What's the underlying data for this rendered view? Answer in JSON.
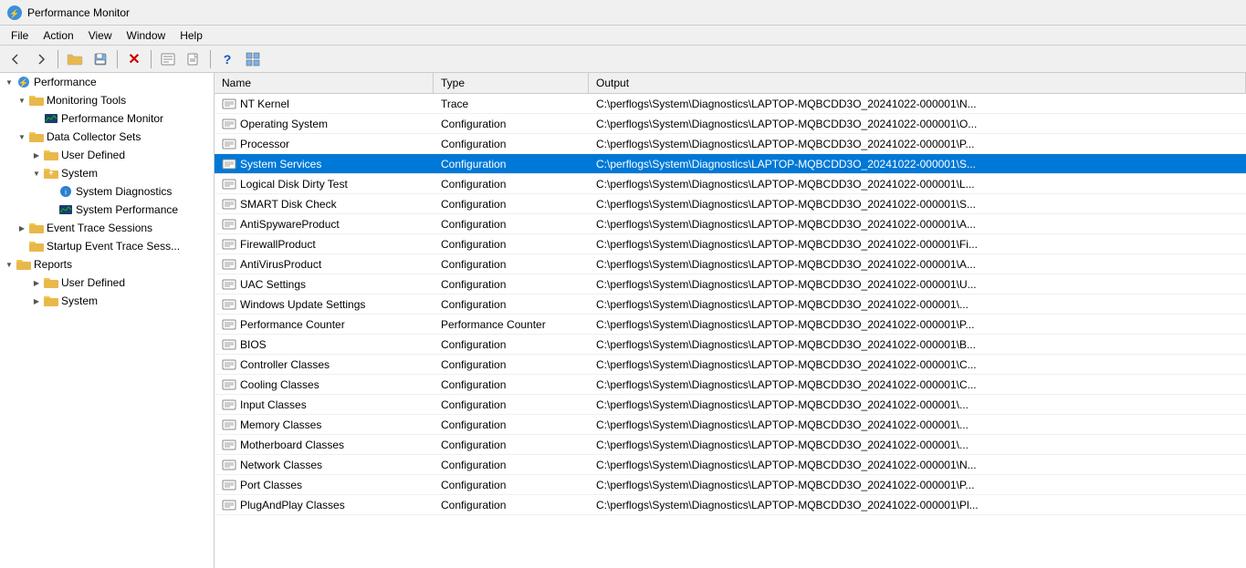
{
  "titleBar": {
    "icon": "●",
    "title": "Performance Monitor"
  },
  "menuBar": {
    "items": [
      "File",
      "Action",
      "View",
      "Window",
      "Help"
    ]
  },
  "toolbar": {
    "buttons": [
      {
        "name": "back",
        "icon": "◄",
        "label": "Back"
      },
      {
        "name": "forward",
        "icon": "►",
        "label": "Forward"
      },
      {
        "name": "separator1",
        "type": "separator"
      },
      {
        "name": "open",
        "icon": "📂",
        "label": "Open"
      },
      {
        "name": "save",
        "icon": "💾",
        "label": "Save"
      },
      {
        "name": "separator2",
        "type": "separator"
      },
      {
        "name": "delete",
        "icon": "✕",
        "label": "Delete"
      },
      {
        "name": "separator3",
        "type": "separator"
      },
      {
        "name": "properties",
        "icon": "≡",
        "label": "Properties"
      },
      {
        "name": "new",
        "icon": "📄",
        "label": "New"
      },
      {
        "name": "separator4",
        "type": "separator"
      },
      {
        "name": "help",
        "icon": "?",
        "label": "Help"
      },
      {
        "name": "view",
        "icon": "⊞",
        "label": "View"
      }
    ]
  },
  "sidebar": {
    "items": [
      {
        "id": "performance",
        "label": "Performance",
        "level": 0,
        "expanded": true,
        "icon": "perf",
        "type": "root"
      },
      {
        "id": "monitoring-tools",
        "label": "Monitoring Tools",
        "level": 1,
        "expanded": true,
        "icon": "folder",
        "type": "folder"
      },
      {
        "id": "performance-monitor",
        "label": "Performance Monitor",
        "level": 2,
        "expanded": false,
        "icon": "monitor",
        "type": "leaf"
      },
      {
        "id": "data-collector-sets",
        "label": "Data Collector Sets",
        "level": 1,
        "expanded": true,
        "icon": "folder",
        "type": "folder"
      },
      {
        "id": "user-defined-1",
        "label": "User Defined",
        "level": 2,
        "expanded": false,
        "icon": "folder",
        "type": "folder"
      },
      {
        "id": "system",
        "label": "System",
        "level": 2,
        "expanded": true,
        "icon": "folder-open",
        "type": "folder"
      },
      {
        "id": "system-diagnostics",
        "label": "System Diagnostics",
        "level": 3,
        "expanded": false,
        "icon": "diag",
        "type": "leaf",
        "selected": false
      },
      {
        "id": "system-performance",
        "label": "System Performance",
        "level": 3,
        "expanded": false,
        "icon": "chart",
        "type": "leaf"
      },
      {
        "id": "event-trace-sessions",
        "label": "Event Trace Sessions",
        "level": 1,
        "expanded": false,
        "icon": "folder",
        "type": "folder"
      },
      {
        "id": "startup-event-trace",
        "label": "Startup Event Trace Sess...",
        "level": 1,
        "expanded": false,
        "icon": "folder",
        "type": "folder"
      },
      {
        "id": "reports",
        "label": "Reports",
        "level": 0,
        "expanded": true,
        "icon": "folder",
        "type": "folder"
      },
      {
        "id": "user-defined-2",
        "label": "User Defined",
        "level": 2,
        "expanded": false,
        "icon": "folder",
        "type": "folder"
      },
      {
        "id": "system-2",
        "label": "System",
        "level": 2,
        "expanded": false,
        "icon": "folder",
        "type": "folder"
      }
    ]
  },
  "listView": {
    "columns": [
      {
        "id": "name",
        "label": "Name"
      },
      {
        "id": "type",
        "label": "Type"
      },
      {
        "id": "output",
        "label": "Output"
      }
    ],
    "rows": [
      {
        "name": "NT Kernel",
        "type": "Trace",
        "output": "C:\\perflogs\\System\\Diagnostics\\LAPTOP-MQBCDD3O_20241022-000001\\N...",
        "selected": false
      },
      {
        "name": "Operating System",
        "type": "Configuration",
        "output": "C:\\perflogs\\System\\Diagnostics\\LAPTOP-MQBCDD3O_20241022-000001\\O...",
        "selected": false
      },
      {
        "name": "Processor",
        "type": "Configuration",
        "output": "C:\\perflogs\\System\\Diagnostics\\LAPTOP-MQBCDD3O_20241022-000001\\P...",
        "selected": false
      },
      {
        "name": "System Services",
        "type": "Configuration",
        "output": "C:\\perflogs\\System\\Diagnostics\\LAPTOP-MQBCDD3O_20241022-000001\\S...",
        "selected": true
      },
      {
        "name": "Logical Disk Dirty Test",
        "type": "Configuration",
        "output": "C:\\perflogs\\System\\Diagnostics\\LAPTOP-MQBCDD3O_20241022-000001\\L...",
        "selected": false
      },
      {
        "name": "SMART Disk Check",
        "type": "Configuration",
        "output": "C:\\perflogs\\System\\Diagnostics\\LAPTOP-MQBCDD3O_20241022-000001\\S...",
        "selected": false
      },
      {
        "name": "AntiSpywareProduct",
        "type": "Configuration",
        "output": "C:\\perflogs\\System\\Diagnostics\\LAPTOP-MQBCDD3O_20241022-000001\\A...",
        "selected": false
      },
      {
        "name": "FirewallProduct",
        "type": "Configuration",
        "output": "C:\\perflogs\\System\\Diagnostics\\LAPTOP-MQBCDD3O_20241022-000001\\Fi...",
        "selected": false
      },
      {
        "name": "AntiVirusProduct",
        "type": "Configuration",
        "output": "C:\\perflogs\\System\\Diagnostics\\LAPTOP-MQBCDD3O_20241022-000001\\A...",
        "selected": false
      },
      {
        "name": "UAC Settings",
        "type": "Configuration",
        "output": "C:\\perflogs\\System\\Diagnostics\\LAPTOP-MQBCDD3O_20241022-000001\\U...",
        "selected": false
      },
      {
        "name": "Windows Update Settings",
        "type": "Configuration",
        "output": "C:\\perflogs\\System\\Diagnostics\\LAPTOP-MQBCDD3O_20241022-000001\\...",
        "selected": false
      },
      {
        "name": "Performance Counter",
        "type": "Performance Counter",
        "output": "C:\\perflogs\\System\\Diagnostics\\LAPTOP-MQBCDD3O_20241022-000001\\P...",
        "selected": false
      },
      {
        "name": "BIOS",
        "type": "Configuration",
        "output": "C:\\perflogs\\System\\Diagnostics\\LAPTOP-MQBCDD3O_20241022-000001\\B...",
        "selected": false
      },
      {
        "name": "Controller Classes",
        "type": "Configuration",
        "output": "C:\\perflogs\\System\\Diagnostics\\LAPTOP-MQBCDD3O_20241022-000001\\C...",
        "selected": false
      },
      {
        "name": "Cooling Classes",
        "type": "Configuration",
        "output": "C:\\perflogs\\System\\Diagnostics\\LAPTOP-MQBCDD3O_20241022-000001\\C...",
        "selected": false
      },
      {
        "name": "Input Classes",
        "type": "Configuration",
        "output": "C:\\perflogs\\System\\Diagnostics\\LAPTOP-MQBCDD3O_20241022-000001\\...",
        "selected": false
      },
      {
        "name": "Memory Classes",
        "type": "Configuration",
        "output": "C:\\perflogs\\System\\Diagnostics\\LAPTOP-MQBCDD3O_20241022-000001\\...",
        "selected": false
      },
      {
        "name": "Motherboard Classes",
        "type": "Configuration",
        "output": "C:\\perflogs\\System\\Diagnostics\\LAPTOP-MQBCDD3O_20241022-000001\\...",
        "selected": false
      },
      {
        "name": "Network Classes",
        "type": "Configuration",
        "output": "C:\\perflogs\\System\\Diagnostics\\LAPTOP-MQBCDD3O_20241022-000001\\N...",
        "selected": false
      },
      {
        "name": "Port Classes",
        "type": "Configuration",
        "output": "C:\\perflogs\\System\\Diagnostics\\LAPTOP-MQBCDD3O_20241022-000001\\P...",
        "selected": false
      },
      {
        "name": "PlugAndPlay Classes",
        "type": "Configuration",
        "output": "C:\\perflogs\\System\\Diagnostics\\LAPTOP-MQBCDD3O_20241022-000001\\Pl...",
        "selected": false
      }
    ]
  },
  "colors": {
    "selectedBg": "#0078d7",
    "selectedText": "#ffffff",
    "hoverBg": "#e8f0fb",
    "headerBg": "#f0f0f0",
    "borderColor": "#cccccc"
  }
}
